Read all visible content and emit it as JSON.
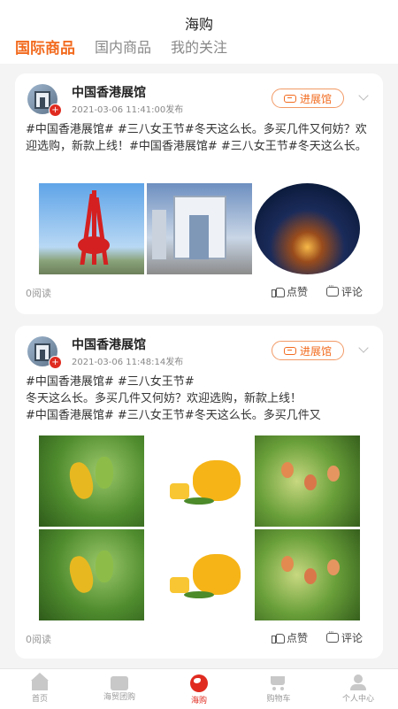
{
  "header": {
    "title": "海购",
    "tabs": [
      {
        "label": "国际商品",
        "active": true
      },
      {
        "label": "国内商品",
        "active": false
      },
      {
        "label": "我的关注",
        "active": false
      }
    ]
  },
  "colors": {
    "accent": "#f26b1f",
    "active_tab_bar": "#e02b20"
  },
  "posts": [
    {
      "author": "中国香港展馆",
      "time": "2021-03-06 11:41:00发布",
      "enter_label": "进展馆",
      "text": "#中国香港展馆# #三八女王节#冬天这么长。多买几件又何妨？欢迎选购，新款上线！#中国香港展馆# #三八女王节#冬天这么长。多买几件又何妨？欢迎选购，新款...",
      "reads": "0阅读",
      "like_label": "点赞",
      "comment_label": "评论"
    },
    {
      "author": "中国香港展馆",
      "time": "2021-03-06 11:48:14发布",
      "enter_label": "进展馆",
      "text": "#中国香港展馆# #三八女王节#\n冬天这么长。多买几件又何妨？欢迎选购，新款上线！\n#中国香港展馆# #三八女王节#冬天这么长。多买几件又",
      "reads": "0阅读",
      "like_label": "点赞",
      "comment_label": "评论"
    }
  ],
  "tabbar": [
    {
      "label": "首页",
      "icon": "home-icon",
      "active": false
    },
    {
      "label": "海贸团购",
      "icon": "shopping-bag-icon",
      "active": false
    },
    {
      "label": "海购",
      "icon": "globe-icon",
      "active": true
    },
    {
      "label": "购物车",
      "icon": "cart-icon",
      "active": false
    },
    {
      "label": "个人中心",
      "icon": "user-icon",
      "active": false
    }
  ]
}
